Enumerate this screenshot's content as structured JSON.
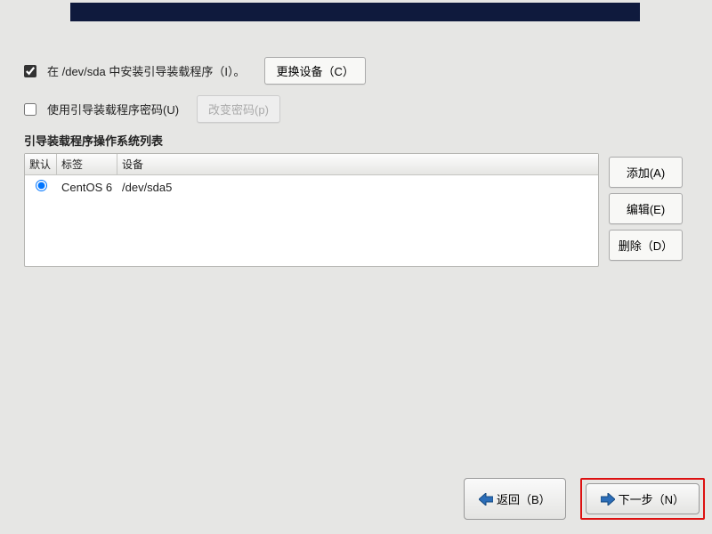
{
  "install_bootloader": {
    "checked": true,
    "label": "在 /dev/sda 中安装引导装载程序（I）。",
    "change_device_btn": "更换设备（C）"
  },
  "use_password": {
    "checked": false,
    "label": "使用引导装载程序密码(U)",
    "change_pw_btn": "改变密码(p)"
  },
  "os_list": {
    "title": "引导装载程序操作系统列表",
    "headers": {
      "default": "默认",
      "label": "标签",
      "device": "设备"
    },
    "rows": [
      {
        "default": true,
        "label": "CentOS 6",
        "device": "/dev/sda5"
      }
    ]
  },
  "side": {
    "add": "添加(A)",
    "edit": "编辑(E)",
    "delete": "删除（D）"
  },
  "nav": {
    "back": "返回（B）",
    "next": "下一步（N）"
  }
}
